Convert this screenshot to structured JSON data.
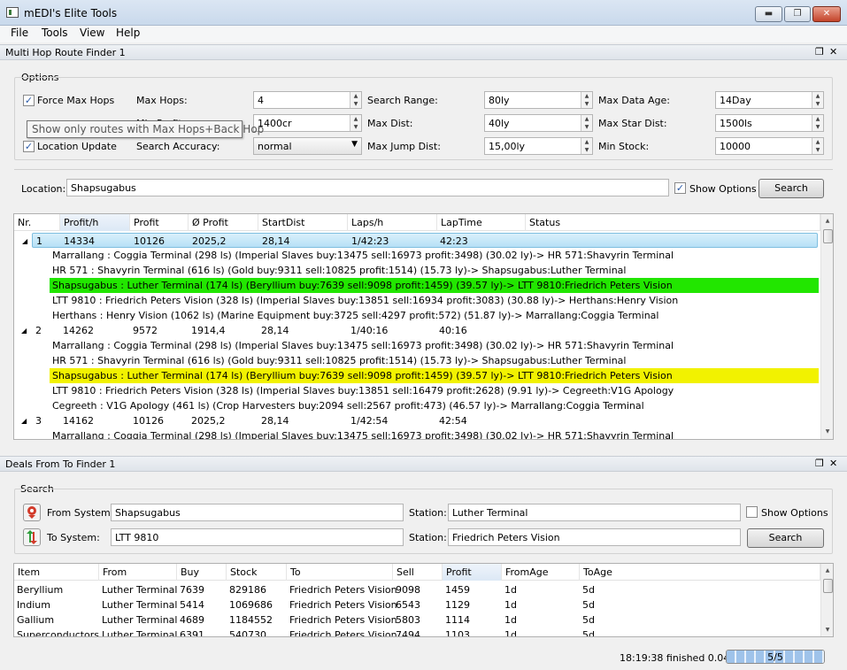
{
  "window": {
    "title": "mEDI's Elite Tools"
  },
  "menu": [
    "File",
    "Tools",
    "View",
    "Help"
  ],
  "route_panel": {
    "title": "Multi Hop Route Finder 1",
    "options_label": "Options",
    "force_max_hops": {
      "label": "Force Max Hops",
      "checked": true
    },
    "location_update": {
      "label": "Location Update",
      "checked": true
    },
    "max_hops": {
      "label": "Max Hops:",
      "value": "4"
    },
    "min_profit": {
      "label": "Min Profit:",
      "value": "1400cr"
    },
    "search_accuracy": {
      "label": "Search Accuracy:",
      "value": "normal"
    },
    "search_range": {
      "label": "Search Range:",
      "value": "80ly"
    },
    "max_dist": {
      "label": "Max Dist:",
      "value": "40ly"
    },
    "max_jump_dist": {
      "label": "Max Jump Dist:",
      "value": "15,00ly"
    },
    "max_data_age": {
      "label": "Max Data Age:",
      "value": "14Day"
    },
    "max_star_dist": {
      "label": "Max Star Dist:",
      "value": "1500ls"
    },
    "min_stock": {
      "label": "Min Stock:",
      "value": "10000"
    },
    "tooltip": "Show only routes with Max Hops+Back Hop",
    "location_label": "Location:",
    "location_value": "Shapsugabus",
    "show_options": {
      "label": "Show Options",
      "checked": true
    },
    "search_button": "Search",
    "columns": [
      "Nr.",
      "Profit/h",
      "Profit",
      "Ø Profit",
      "StartDist",
      "Laps/h",
      "LapTime",
      "Status"
    ],
    "rows": [
      {
        "type": "route",
        "nr": "1",
        "profit_h": "14334",
        "profit": "10126",
        "avg": "2025,2",
        "startdist": "28,14",
        "laps": "1/42:23",
        "laptime": "42:23",
        "status": ""
      },
      {
        "type": "hop",
        "text": "Marrallang : Coggia Terminal (298 ls) (Imperial Slaves buy:13475 sell:16973 profit:3498) (30.02 ly)-> HR 571:Shavyrin Terminal",
        "hl": ""
      },
      {
        "type": "hop",
        "text": "HR 571 : Shavyrin Terminal (616 ls) (Gold buy:9311 sell:10825 profit:1514) (15.73 ly)-> Shapsugabus:Luther Terminal",
        "hl": ""
      },
      {
        "type": "hop",
        "text": "Shapsugabus : Luther Terminal (174 ls) (Beryllium buy:7639 sell:9098 profit:1459) (39.57 ly)-> LTT 9810:Friedrich Peters Vision",
        "hl": "#22e600"
      },
      {
        "type": "hop",
        "text": "LTT 9810 : Friedrich Peters Vision (328 ls) (Imperial Slaves buy:13851 sell:16934 profit:3083) (30.88 ly)-> Herthans:Henry Vision",
        "hl": ""
      },
      {
        "type": "hop",
        "text": "Herthans : Henry Vision (1062 ls) (Marine Equipment buy:3725 sell:4297 profit:572) (51.87 ly)-> Marrallang:Coggia Terminal",
        "hl": ""
      },
      {
        "type": "route",
        "nr": "2",
        "profit_h": "14262",
        "profit": "9572",
        "avg": "1914,4",
        "startdist": "28,14",
        "laps": "1/40:16",
        "laptime": "40:16",
        "status": ""
      },
      {
        "type": "hop",
        "text": "Marrallang : Coggia Terminal (298 ls) (Imperial Slaves buy:13475 sell:16973 profit:3498) (30.02 ly)-> HR 571:Shavyrin Terminal",
        "hl": ""
      },
      {
        "type": "hop",
        "text": "HR 571 : Shavyrin Terminal (616 ls) (Gold buy:9311 sell:10825 profit:1514) (15.73 ly)-> Shapsugabus:Luther Terminal",
        "hl": ""
      },
      {
        "type": "hop",
        "text": "Shapsugabus : Luther Terminal (174 ls) (Beryllium buy:7639 sell:9098 profit:1459) (39.57 ly)-> LTT 9810:Friedrich Peters Vision",
        "hl": "#f2f200"
      },
      {
        "type": "hop",
        "text": "LTT 9810 : Friedrich Peters Vision (328 ls) (Imperial Slaves buy:13851 sell:16479 profit:2628) (9.91 ly)-> Cegreeth:V1G Apology",
        "hl": ""
      },
      {
        "type": "hop",
        "text": "Cegreeth : V1G Apology (461 ls) (Crop Harvesters buy:2094 sell:2567 profit:473) (46.57 ly)-> Marrallang:Coggia Terminal",
        "hl": ""
      },
      {
        "type": "route",
        "nr": "3",
        "profit_h": "14162",
        "profit": "10126",
        "avg": "2025,2",
        "startdist": "28,14",
        "laps": "1/42:54",
        "laptime": "42:54",
        "status": ""
      },
      {
        "type": "hop",
        "text": "Marrallang : Coggia Terminal (298 ls) (Imperial Slaves buy:13475 sell:16973 profit:3498) (30.02 ly)-> HR 571:Shavyrin Terminal",
        "hl": ""
      }
    ]
  },
  "deals_panel": {
    "title": "Deals From To Finder 1",
    "search_label": "Search",
    "from_system": {
      "label": "From System:",
      "value": "Shapsugabus"
    },
    "to_system": {
      "label": "To System:",
      "value": "LTT 9810"
    },
    "from_station": {
      "label": "Station:",
      "value": "Luther Terminal"
    },
    "to_station": {
      "label": "Station:",
      "value": "Friedrich Peters Vision"
    },
    "show_options": {
      "label": "Show Options",
      "checked": false
    },
    "search_button": "Search",
    "columns": [
      "Item",
      "From",
      "Buy",
      "Stock",
      "To",
      "Sell",
      "Profit",
      "FromAge",
      "ToAge"
    ],
    "rows": [
      [
        "Beryllium",
        "Luther Terminal",
        "7639",
        "829186",
        "Friedrich Peters Vision",
        "9098",
        "1459",
        "1d",
        "5d"
      ],
      [
        "Indium",
        "Luther Terminal",
        "5414",
        "1069686",
        "Friedrich Peters Vision",
        "6543",
        "1129",
        "1d",
        "5d"
      ],
      [
        "Gallium",
        "Luther Terminal",
        "4689",
        "1184552",
        "Friedrich Peters Vision",
        "5803",
        "1114",
        "1d",
        "5d"
      ],
      [
        "Superconductors",
        "Luther Terminal",
        "6391",
        "540730",
        "Friedrich Peters Vision",
        "7494",
        "1103",
        "1d",
        "5d"
      ]
    ]
  },
  "status": {
    "text": "18:19:38 finished 0.04s",
    "progress_label": "5/5",
    "progress": 1.0
  }
}
